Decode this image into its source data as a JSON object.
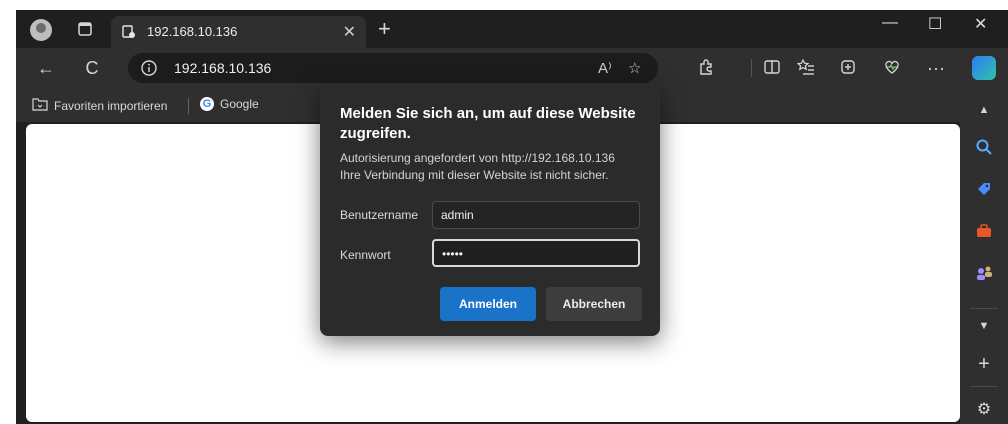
{
  "window": {
    "tab_title": "192.168.10.136",
    "new_tab_symbol": "+",
    "close_symbol": "✕"
  },
  "controls": {
    "minimize": "—",
    "maximize": "☐",
    "close": "✕"
  },
  "toolbar": {
    "back": "←",
    "reload": "C",
    "info": "ⓘ",
    "url": "192.168.10.136",
    "read_aloud": "A⁾",
    "favorite_star": "☆",
    "more": "···"
  },
  "favorites": {
    "import_label": "Favoriten importieren",
    "google_label": "Google",
    "google_letter": "G"
  },
  "dialog": {
    "title": "Melden Sie sich an, um auf diese Website zugreifen.",
    "line1": "Autorisierung angefordert von http://192.168.10.136",
    "line2": "Ihre Verbindung mit dieser Website ist nicht sicher.",
    "username_label": "Benutzername",
    "username_value": "admin",
    "password_label": "Kennwort",
    "password_value": "•••••",
    "sign_in_button": "Anmelden",
    "cancel_button": "Abbrechen"
  },
  "sidebar": {
    "add": "+",
    "settings": "⚙"
  },
  "colors": {
    "accent": "#1a73c9",
    "dialog_bg": "#2b2b2b",
    "chrome_bg": "#2f2f2f"
  },
  "icons": [
    "profile-icon",
    "tab-actions-icon",
    "site-icon",
    "back-icon",
    "reload-icon",
    "info-icon",
    "read-aloud-icon",
    "star-icon",
    "extensions-icon",
    "split-screen-icon",
    "favorites-icon",
    "collections-icon",
    "performance-icon",
    "more-icon",
    "copilot-icon",
    "search-icon",
    "shopping-icon",
    "tools-icon",
    "games-icon",
    "add-icon",
    "settings-icon"
  ]
}
